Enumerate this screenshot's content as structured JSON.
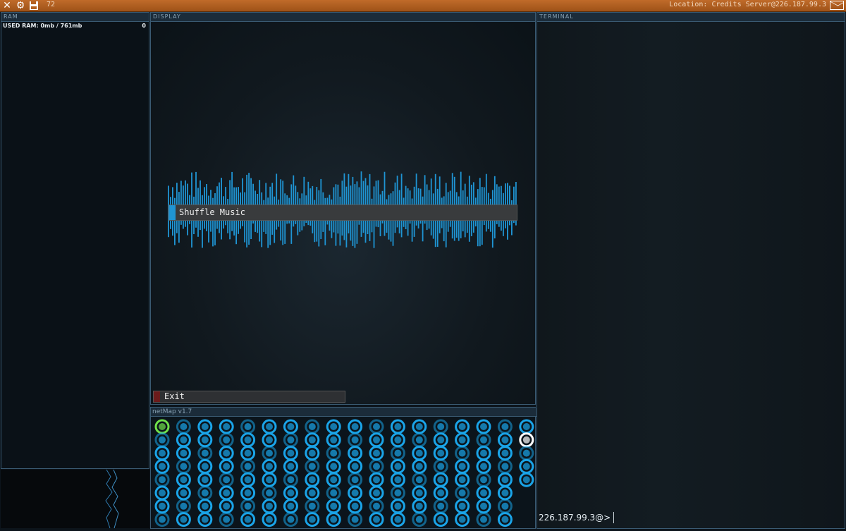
{
  "topbar": {
    "close_icon": "close-icon",
    "settings_icon": "gear-icon",
    "save_icon": "save-icon",
    "count": "72",
    "location": "Location: Credits Server@226.187.99.3",
    "mail_icon": "mail-icon",
    "bar_color": "#b5611f"
  },
  "ram": {
    "header": "RAM",
    "used_label": "USED RAM: 0mb / 761mb",
    "used_value": "0",
    "used_fraction": 0
  },
  "display": {
    "header": "DISPLAY",
    "shuffle_label": "Shuffle Music",
    "exit_label": "Exit",
    "accent": "#1f95d4"
  },
  "terminal": {
    "header": "TERMINAL",
    "prompt": "226.187.99.3@> "
  },
  "netmap": {
    "header": "netMap v1.7",
    "node_color": "#1aa4e8",
    "home_node_color": "#6fe04a",
    "target_node_color": "#ffffff"
  }
}
